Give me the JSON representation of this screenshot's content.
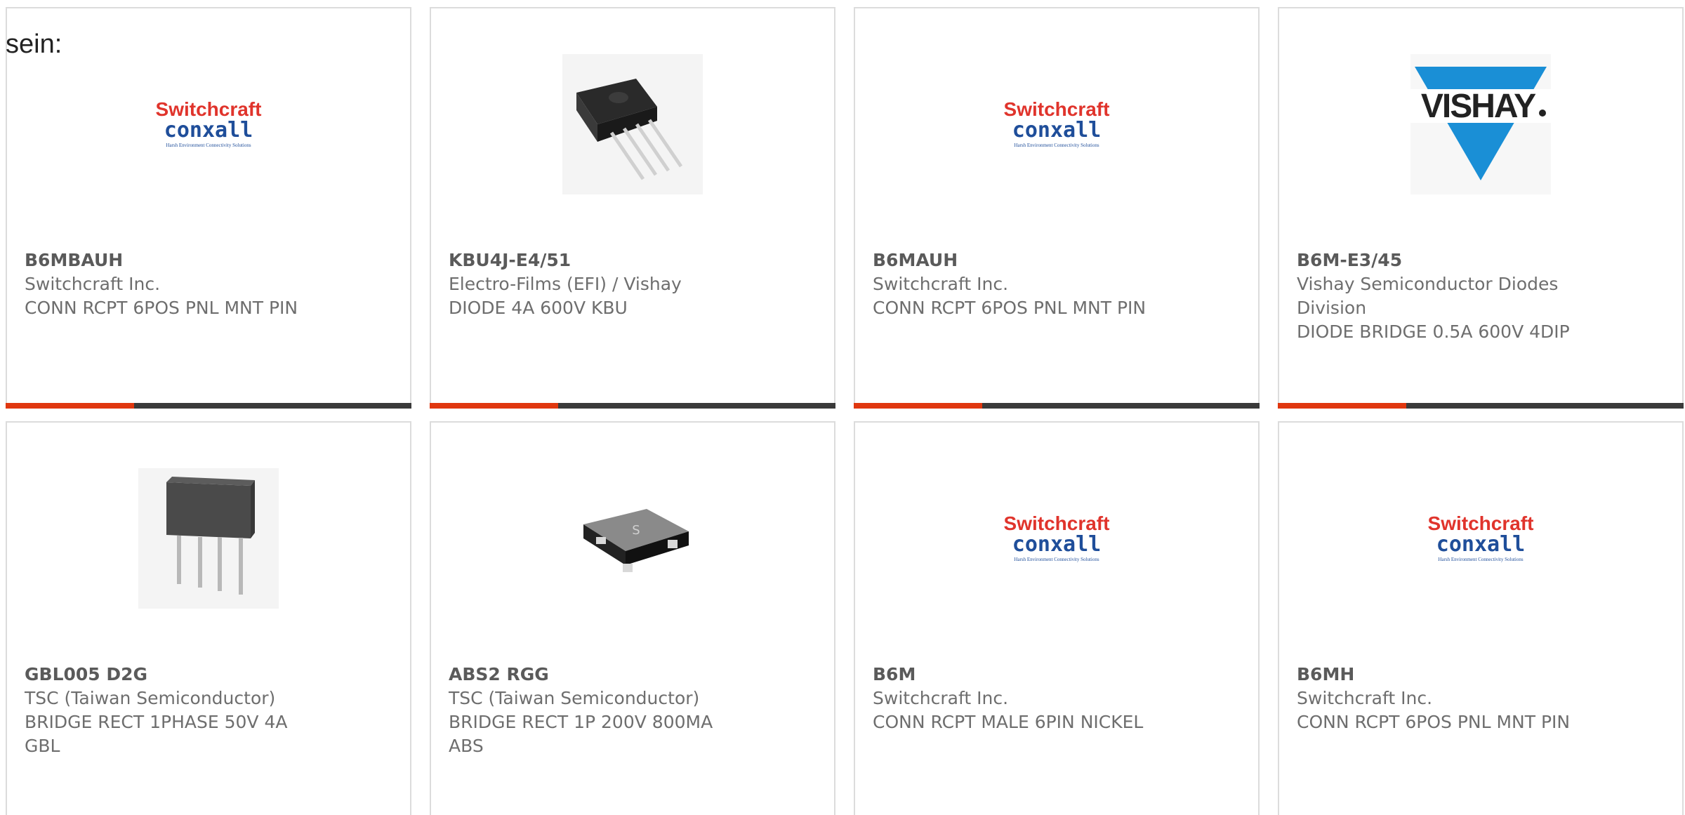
{
  "intro": {
    "text": "sein:"
  },
  "brand_logos": {
    "switchcraft": {
      "top": "Switchcraft",
      "bottom": "conxall",
      "tagline": "Harsh Environment Connectivity Solutions",
      "top_color": "#e0342c",
      "bottom_color": "#1f4e9a"
    },
    "vishay": {
      "text": "VISHAY",
      "triangle_color": "#1a8fd6"
    }
  },
  "colors": {
    "accent": "#e0370f",
    "bar": "#3a3a3a",
    "border": "#dcdcdc",
    "text": "#6e6e6e"
  },
  "products": [
    {
      "part": "B6MBAUH",
      "maker": "Switchcraft Inc.",
      "desc": "CONN RCPT 6POS PNL MNT PIN",
      "image": "switchcraft-logo"
    },
    {
      "part": "KBU4J-E4/51",
      "maker": "Electro-Films (EFI) / Vishay",
      "desc": "DIODE 4A 600V KBU",
      "image": "bridge-rectifier-kbu"
    },
    {
      "part": "B6MAUH",
      "maker": "Switchcraft Inc.",
      "desc": "CONN RCPT 6POS PNL MNT PIN",
      "image": "switchcraft-logo"
    },
    {
      "part": "B6M-E3/45",
      "maker": "Vishay Semiconductor Diodes Division",
      "desc": "DIODE BRIDGE 0.5A 600V 4DIP",
      "image": "vishay-logo"
    },
    {
      "part": "GBL005 D2G",
      "maker": "TSC (Taiwan Semiconductor)",
      "desc": "BRIDGE RECT 1PHASE 50V 4A GBL",
      "image": "bridge-rectifier-gbl"
    },
    {
      "part": "ABS2 RGG",
      "maker": "TSC (Taiwan Semiconductor)",
      "desc": "BRIDGE RECT 1P 200V 800MA ABS",
      "image": "bridge-rectifier-abs"
    },
    {
      "part": "B6M",
      "maker": "Switchcraft Inc.",
      "desc": "CONN RCPT MALE 6PIN NICKEL",
      "image": "switchcraft-logo"
    },
    {
      "part": "B6MH",
      "maker": "Switchcraft Inc.",
      "desc": "CONN RCPT 6POS PNL MNT PIN",
      "image": "switchcraft-logo"
    }
  ]
}
